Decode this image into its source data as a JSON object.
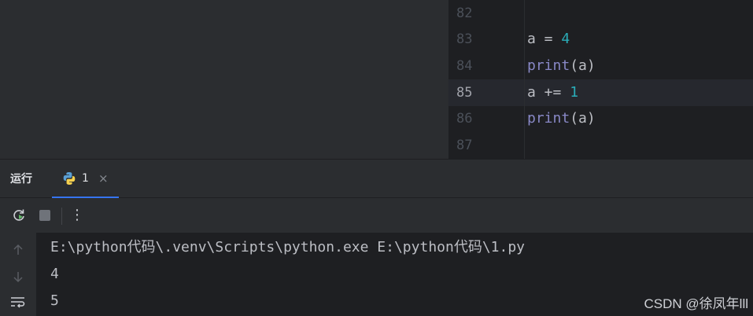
{
  "editor": {
    "lines": [
      {
        "num": "82",
        "parts": []
      },
      {
        "num": "83",
        "parts": [
          {
            "t": "a = ",
            "c": "plain"
          },
          {
            "t": "4",
            "c": "num"
          }
        ]
      },
      {
        "num": "84",
        "parts": [
          {
            "t": "print",
            "c": "fn"
          },
          {
            "t": "(a)",
            "c": "plain"
          }
        ]
      },
      {
        "num": "85",
        "parts": [
          {
            "t": "a += ",
            "c": "plain"
          },
          {
            "t": "1",
            "c": "num"
          }
        ],
        "active": true
      },
      {
        "num": "86",
        "parts": [
          {
            "t": "print",
            "c": "fn"
          },
          {
            "t": "(a)",
            "c": "plain"
          }
        ]
      },
      {
        "num": "87",
        "parts": []
      }
    ]
  },
  "run_panel": {
    "title": "运行",
    "tab_label": "1",
    "tab_close": "×",
    "more_label": "⋮"
  },
  "console": {
    "lines": [
      "E:\\python代码\\.venv\\Scripts\\python.exe E:\\python代码\\1.py",
      "4",
      "5"
    ]
  },
  "watermark": "CSDN @徐凤年lll",
  "colors": {
    "background": "#1e1f22",
    "panel": "#2b2d30",
    "accent": "#3574f0",
    "number": "#2aacb8",
    "function": "#8888c6"
  }
}
